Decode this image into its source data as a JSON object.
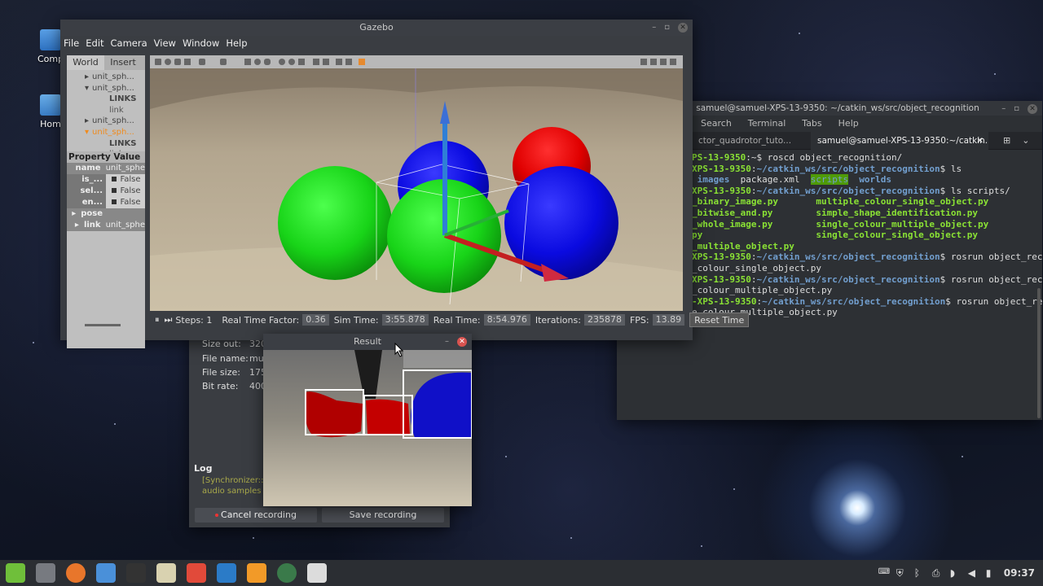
{
  "desktop": {
    "icons": [
      {
        "label": "Comp"
      },
      {
        "label": "Hom"
      }
    ]
  },
  "recorder": {
    "rows": [
      {
        "label": "Size out:",
        "value": "320"
      },
      {
        "label": "File name:",
        "value": "mul"
      },
      {
        "label": "File size:",
        "value": "175"
      },
      {
        "label": "Bit rate:",
        "value": "400"
      }
    ],
    "log_title": "Log",
    "log_lines": [
      "[Synchronizer::",
      "audio samples"
    ],
    "cancel_label": "Cancel recording",
    "save_label": "Save recording"
  },
  "terminal": {
    "title": "samuel@samuel-XPS-13-9350: ~/catkin_ws/src/object_recognition",
    "menu": [
      "Search",
      "Terminal",
      "Tabs",
      "Help"
    ],
    "tabs": [
      {
        "label": "ctor_quadrotor_tuto..."
      },
      {
        "label": "samuel@samuel-XPS-13-9350:~/catkin..."
      }
    ],
    "lines": [
      [
        {
          "t": "PS-13-9350",
          "c": "g"
        },
        {
          "t": ":~$ roscd object_recognition/",
          "c": ""
        }
      ],
      [
        {
          "t": "XPS-13-9350",
          "c": "g"
        },
        {
          "t": ":",
          "c": ""
        },
        {
          "t": "~/catkin_ws/src/object_recognition",
          "c": "b"
        },
        {
          "t": "$ ls",
          "c": ""
        }
      ],
      [
        {
          "t": " images",
          "c": "b"
        },
        {
          "t": "  package.xml  ",
          "c": ""
        },
        {
          "t": "scripts",
          "c": "hl"
        },
        {
          "t": "  ",
          "c": ""
        },
        {
          "t": "worlds",
          "c": "b"
        }
      ],
      [
        {
          "t": "XPS-13-9350",
          "c": "g"
        },
        {
          "t": ":",
          "c": ""
        },
        {
          "t": "~/catkin_ws/src/object_recognition",
          "c": "b"
        },
        {
          "t": "$ ls scripts/",
          "c": ""
        }
      ],
      [
        {
          "t": "_binary_image.py       multiple_colour_single_object.py",
          "c": "g"
        }
      ],
      [
        {
          "t": "_bitwise_and.py        simple_shape_identification.py",
          "c": "g"
        }
      ],
      [
        {
          "t": "_whole_image.py        single_colour_multiple_object.py",
          "c": "g"
        }
      ],
      [
        {
          "t": "py                     single_colour_single_object.py",
          "c": "g"
        }
      ],
      [
        {
          "t": "_multiple_object.py",
          "c": "g"
        }
      ],
      [
        {
          "t": "XPS-13-9350",
          "c": "g"
        },
        {
          "t": ":",
          "c": ""
        },
        {
          "t": "~/catkin_ws/src/object_recognition",
          "c": "b"
        },
        {
          "t": "$ rosrun object_reco",
          "c": ""
        }
      ],
      [
        {
          "t": "_colour_single_object.py",
          "c": ""
        }
      ],
      [
        {
          "t": "XPS-13-9350",
          "c": "g"
        },
        {
          "t": ":",
          "c": ""
        },
        {
          "t": "~/catkin_ws/src/object_recognition",
          "c": "b"
        },
        {
          "t": "$ rosrun object_reco",
          "c": ""
        }
      ],
      [
        {
          "t": "_colour_multiple_object.py",
          "c": ""
        }
      ],
      [
        {
          "t": "-XPS-13-9350",
          "c": "g"
        },
        {
          "t": ":",
          "c": ""
        },
        {
          "t": "~/catkin_ws/src/object_recognition",
          "c": "b"
        },
        {
          "t": "$ rosrun object_re",
          "c": ""
        }
      ],
      [
        {
          "t": "e_colour_multiple_object.py",
          "c": ""
        }
      ]
    ]
  },
  "gazebo": {
    "title": "Gazebo",
    "menu": [
      "File",
      "Edit",
      "Camera",
      "View",
      "Window",
      "Help"
    ],
    "left_tabs": [
      "World",
      "Insert"
    ],
    "tree": [
      {
        "label": "unit_sph...",
        "arrow": "▸",
        "indent": 22,
        "color": "#444"
      },
      {
        "label": "unit_sph...",
        "arrow": "▾",
        "indent": 22,
        "color": "#444"
      },
      {
        "label": "LINKS",
        "arrow": "",
        "indent": 48,
        "color": "#444",
        "bold": true
      },
      {
        "label": "link",
        "arrow": "",
        "indent": 48,
        "color": "#555"
      },
      {
        "label": "unit_sph...",
        "arrow": "▸",
        "indent": 22,
        "color": "#444"
      },
      {
        "label": "unit_sph...",
        "arrow": "▾",
        "indent": 22,
        "color": "#f08a1c"
      },
      {
        "label": "LINKS",
        "arrow": "",
        "indent": 48,
        "color": "#444",
        "bold": true
      },
      {
        "label": "link",
        "arrow": "",
        "indent": 48,
        "color": "#555"
      }
    ],
    "prop_header": "Property Value",
    "props": [
      {
        "k": "name",
        "v": "unit_sphe",
        "dark": true
      },
      {
        "k": "is_...",
        "v": "False",
        "check": true
      },
      {
        "k": "sel...",
        "v": "False",
        "check": true
      },
      {
        "k": "en...",
        "v": "False",
        "check": true
      },
      {
        "k": "pose",
        "v": "",
        "arrow": "▸",
        "dark": true
      },
      {
        "k": "link",
        "v": "unit_sphe",
        "arrow": "▸",
        "dark": true
      }
    ],
    "status": {
      "steps_label": "Steps: 1",
      "rtf_label": "Real Time Factor:",
      "rtf": "0.36",
      "sim_label": "Sim Time:",
      "sim": "3:55.878",
      "real_label": "Real Time:",
      "real": "8:54.976",
      "iter_label": "Iterations:",
      "iter": "235878",
      "fps_label": "FPS:",
      "fps": "13.89",
      "reset_label": "Reset Time"
    }
  },
  "result": {
    "title": "Result"
  },
  "taskbar": {
    "apps": [
      {
        "name": "mint-menu-icon",
        "color": "#6fbf3a"
      },
      {
        "name": "show-desktop-icon",
        "color": "#777a80"
      },
      {
        "name": "firefox-icon",
        "color": "#e8762b"
      },
      {
        "name": "files-icon",
        "color": "#4a90d9"
      },
      {
        "name": "terminal-icon",
        "color": "#333"
      },
      {
        "name": "text-editor-icon",
        "color": "#d9d2b0"
      },
      {
        "name": "system-monitor-icon",
        "color": "#e14a3a"
      },
      {
        "name": "vscode-icon",
        "color": "#2b7bc7"
      },
      {
        "name": "sublime-icon",
        "color": "#f29a28"
      },
      {
        "name": "browser-icon",
        "color": "#3a7a4a"
      },
      {
        "name": "settings-icon",
        "color": "#dcdcdc"
      }
    ],
    "clock": "09:37"
  }
}
